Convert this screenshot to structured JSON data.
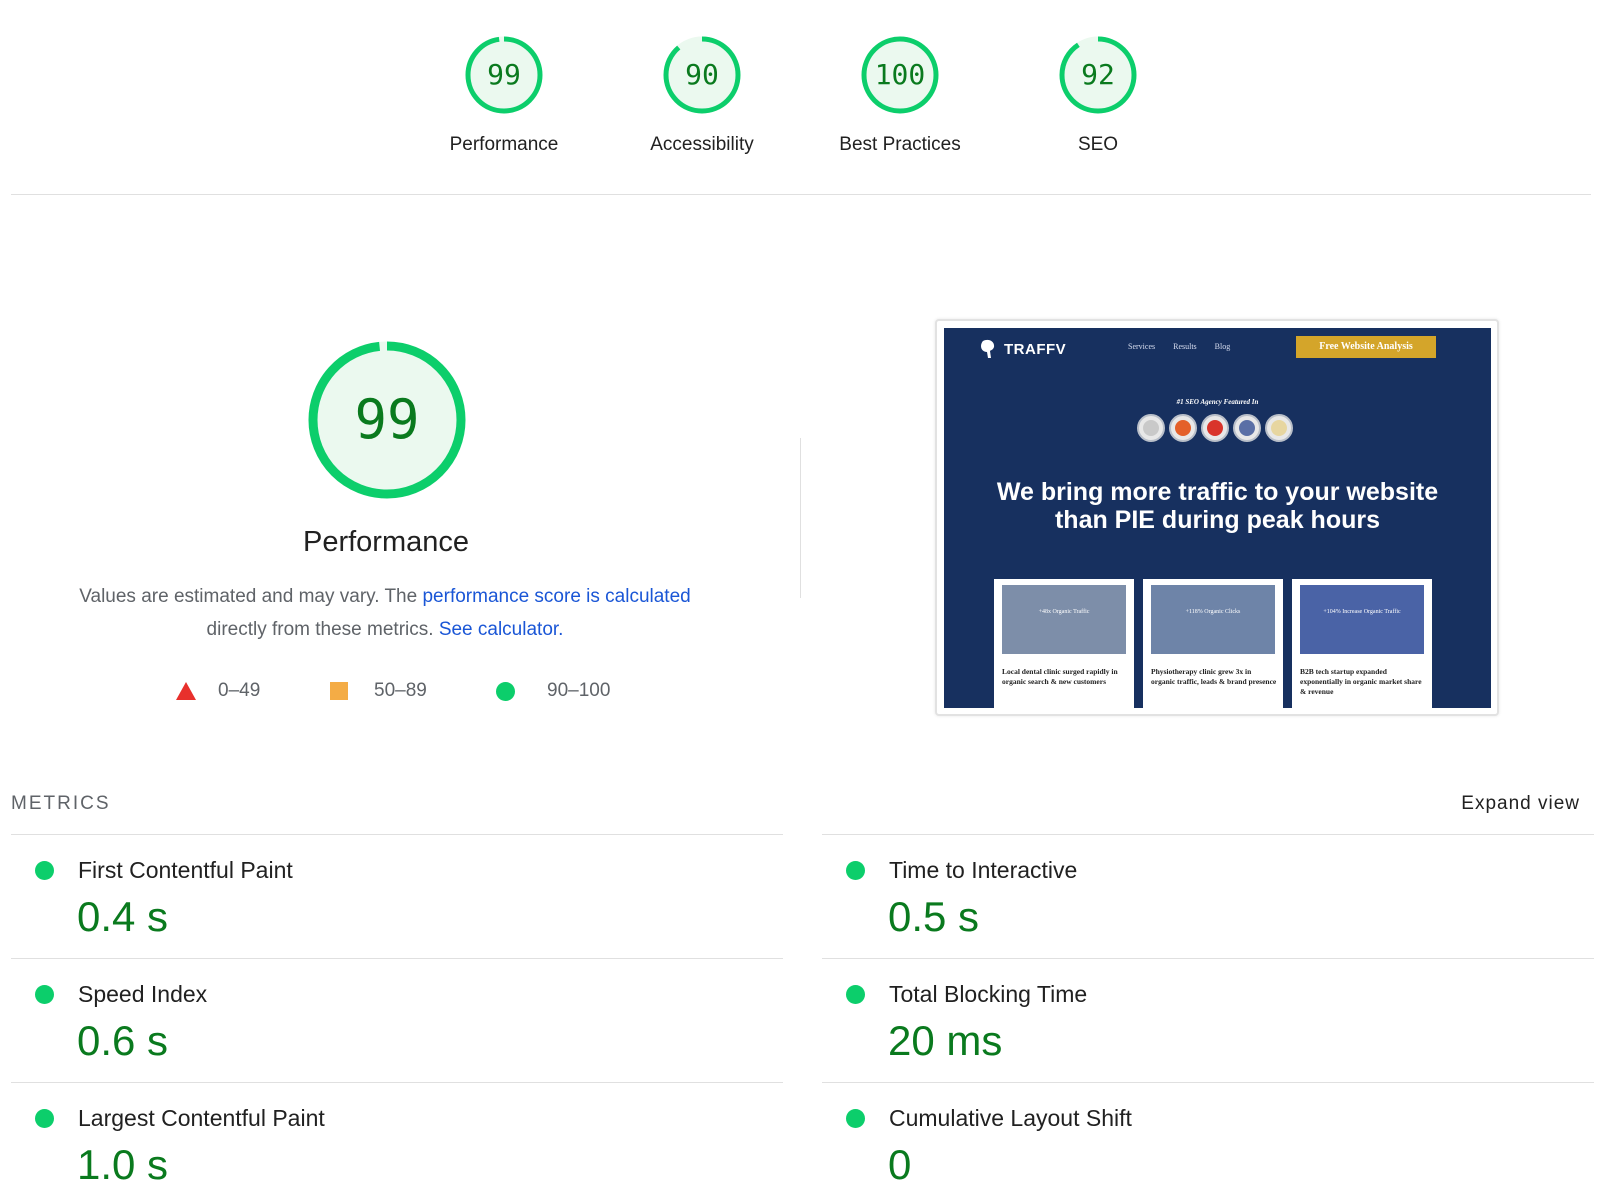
{
  "colors": {
    "pass": "#0cce6b",
    "pass_text": "#0a7a1e",
    "average": "#f4ac45",
    "fail": "#e8302c",
    "link": "#1a56d6"
  },
  "categories": [
    {
      "score": "99",
      "label": "Performance",
      "fraction": 0.99
    },
    {
      "score": "90",
      "label": "Accessibility",
      "fraction": 0.9
    },
    {
      "score": "100",
      "label": "Best Practices",
      "fraction": 1.0
    },
    {
      "score": "92",
      "label": "SEO",
      "fraction": 0.92
    }
  ],
  "performance": {
    "score": "99",
    "fraction": 0.99,
    "title": "Performance",
    "desc_prefix": "Values are estimated and may vary. The ",
    "desc_link": "performance score is calculated",
    "desc_middle": " directly from these metrics. ",
    "desc_link2": "See calculator.",
    "legend": {
      "fail": "0–49",
      "average": "50–89",
      "pass": "90–100"
    }
  },
  "screenshot": {
    "brand": "TRAFFV",
    "nav": [
      "Services",
      "Results",
      "Blog"
    ],
    "cta": "Free Website Analysis",
    "featured": "#1 SEO Agency Featured In",
    "badge_icons": [
      "badge-icon-1",
      "badge-icon-2",
      "badge-icon-3",
      "badge-icon-4",
      "badge-icon-5"
    ],
    "badge_colors": [
      "#c9c9c9",
      "#e4602a",
      "#d9342b",
      "#5a6fa6",
      "#e7d6a0"
    ],
    "headline_line1": "We bring more traffic to your website",
    "headline_line2": "than PIE during peak hours",
    "cards": [
      {
        "caption": "+48x Organic Traffic",
        "text": "Local dental clinic surged rapidly in organic search & new customers"
      },
      {
        "caption": "+118% Organic Clicks",
        "text": "Physiotherapy clinic grew 3x in organic traffic, leads & brand presence"
      },
      {
        "caption": "+104% Increase Organic Traffic",
        "text": "B2B tech startup expanded exponentially in organic market share & revenue"
      }
    ]
  },
  "metrics": {
    "heading": "METRICS",
    "expand": "Expand view",
    "left": [
      {
        "title": "First Contentful Paint",
        "value": "0.4 s"
      },
      {
        "title": "Speed Index",
        "value": "0.6 s"
      },
      {
        "title": "Largest Contentful Paint",
        "value": "1.0 s"
      }
    ],
    "right": [
      {
        "title": "Time to Interactive",
        "value": "0.5 s"
      },
      {
        "title": "Total Blocking Time",
        "value": "20 ms"
      },
      {
        "title": "Cumulative Layout Shift",
        "value": "0"
      }
    ]
  }
}
